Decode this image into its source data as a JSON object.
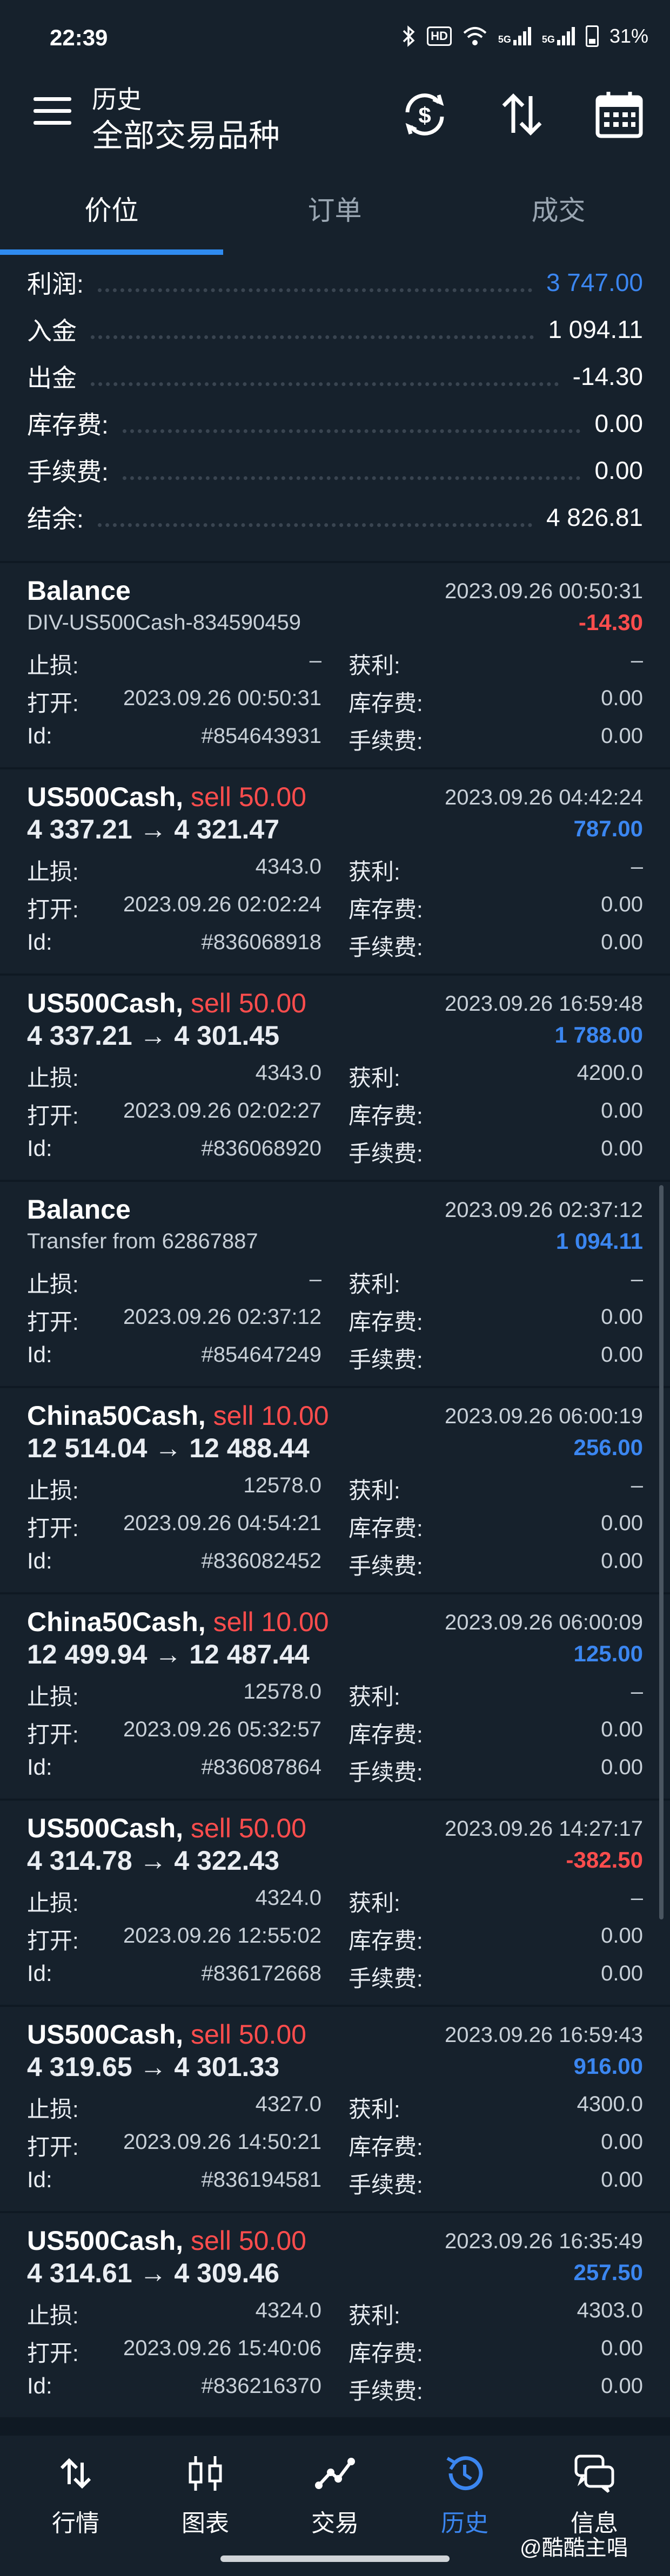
{
  "status": {
    "time": "22:39",
    "battery": "31%",
    "hd": "HD",
    "net1": "5G",
    "net2": "5G"
  },
  "header": {
    "title": "历史",
    "subtitle": "全部交易品种"
  },
  "tabs": [
    "价位",
    "订单",
    "成交"
  ],
  "summary": [
    {
      "label": "利润:",
      "value": "3 747.00",
      "highlight": true
    },
    {
      "label": "入金",
      "value": "1 094.11"
    },
    {
      "label": "出金",
      "value": "-14.30"
    },
    {
      "label": "库存费:",
      "value": "0.00"
    },
    {
      "label": "手续费:",
      "value": "0.00"
    },
    {
      "label": "结余:",
      "value": "4 826.81"
    }
  ],
  "labels": {
    "sl": "止损:",
    "tp": "获利:",
    "open": "打开:",
    "swap": "库存费:",
    "id": "Id:",
    "fee": "手续费:"
  },
  "cards": [
    {
      "symbol": "Balance",
      "side": "",
      "sub": "DIV-US500Cash-834590459",
      "sub_plain": true,
      "time": "2023.09.26 00:50:31",
      "profit": "-14.30",
      "negative": true,
      "sl": "–",
      "tp": "–",
      "open": "2023.09.26 00:50:31",
      "swap": "0.00",
      "id": "#854643931",
      "fee": "0.00"
    },
    {
      "symbol": "US500Cash,",
      "side": "sell 50.00",
      "sub": "4 337.21 → 4 321.47",
      "sub_plain": false,
      "time": "2023.09.26 04:42:24",
      "profit": "787.00",
      "negative": false,
      "sl": "4343.0",
      "tp": "–",
      "open": "2023.09.26 02:02:24",
      "swap": "0.00",
      "id": "#836068918",
      "fee": "0.00"
    },
    {
      "symbol": "US500Cash,",
      "side": "sell 50.00",
      "sub": "4 337.21 → 4 301.45",
      "sub_plain": false,
      "time": "2023.09.26 16:59:48",
      "profit": "1 788.00",
      "negative": false,
      "sl": "4343.0",
      "tp": "4200.0",
      "open": "2023.09.26 02:02:27",
      "swap": "0.00",
      "id": "#836068920",
      "fee": "0.00"
    },
    {
      "symbol": "Balance",
      "side": "",
      "sub": "Transfer from 62867887",
      "sub_plain": true,
      "time": "2023.09.26 02:37:12",
      "profit": "1 094.11",
      "negative": false,
      "sl": "–",
      "tp": "–",
      "open": "2023.09.26 02:37:12",
      "swap": "0.00",
      "id": "#854647249",
      "fee": "0.00"
    },
    {
      "symbol": "China50Cash,",
      "side": "sell 10.00",
      "sub": "12 514.04 → 12 488.44",
      "sub_plain": false,
      "time": "2023.09.26 06:00:19",
      "profit": "256.00",
      "negative": false,
      "sl": "12578.0",
      "tp": "–",
      "open": "2023.09.26 04:54:21",
      "swap": "0.00",
      "id": "#836082452",
      "fee": "0.00"
    },
    {
      "symbol": "China50Cash,",
      "side": "sell 10.00",
      "sub": "12 499.94 → 12 487.44",
      "sub_plain": false,
      "time": "2023.09.26 06:00:09",
      "profit": "125.00",
      "negative": false,
      "sl": "12578.0",
      "tp": "–",
      "open": "2023.09.26 05:32:57",
      "swap": "0.00",
      "id": "#836087864",
      "fee": "0.00"
    },
    {
      "symbol": "US500Cash,",
      "side": "sell 50.00",
      "sub": "4 314.78 → 4 322.43",
      "sub_plain": false,
      "time": "2023.09.26 14:27:17",
      "profit": "-382.50",
      "negative": true,
      "sl": "4324.0",
      "tp": "–",
      "open": "2023.09.26 12:55:02",
      "swap": "0.00",
      "id": "#836172668",
      "fee": "0.00"
    },
    {
      "symbol": "US500Cash,",
      "side": "sell 50.00",
      "sub": "4 319.65 → 4 301.33",
      "sub_plain": false,
      "time": "2023.09.26 16:59:43",
      "profit": "916.00",
      "negative": false,
      "sl": "4327.0",
      "tp": "4300.0",
      "open": "2023.09.26 14:50:21",
      "swap": "0.00",
      "id": "#836194581",
      "fee": "0.00"
    },
    {
      "symbol": "US500Cash,",
      "side": "sell 50.00",
      "sub": "4 314.61 → 4 309.46",
      "sub_plain": false,
      "time": "2023.09.26 16:35:49",
      "profit": "257.50",
      "negative": false,
      "sl": "4324.0",
      "tp": "4303.0",
      "open": "2023.09.26 15:40:06",
      "swap": "0.00",
      "id": "#836216370",
      "fee": "0.00"
    }
  ],
  "bottom_nav": [
    {
      "label": "行情",
      "icon": "quotes-icon"
    },
    {
      "label": "图表",
      "icon": "chart-icon"
    },
    {
      "label": "交易",
      "icon": "trade-icon"
    },
    {
      "label": "历史",
      "icon": "history-icon",
      "active": true
    },
    {
      "label": "信息",
      "icon": "messages-icon"
    }
  ],
  "watermark": "@酷酷主唱",
  "colors": {
    "accent": "#3b86f0",
    "negative": "#ff4d4d",
    "background": "#0f1923",
    "panel": "#16212c"
  }
}
